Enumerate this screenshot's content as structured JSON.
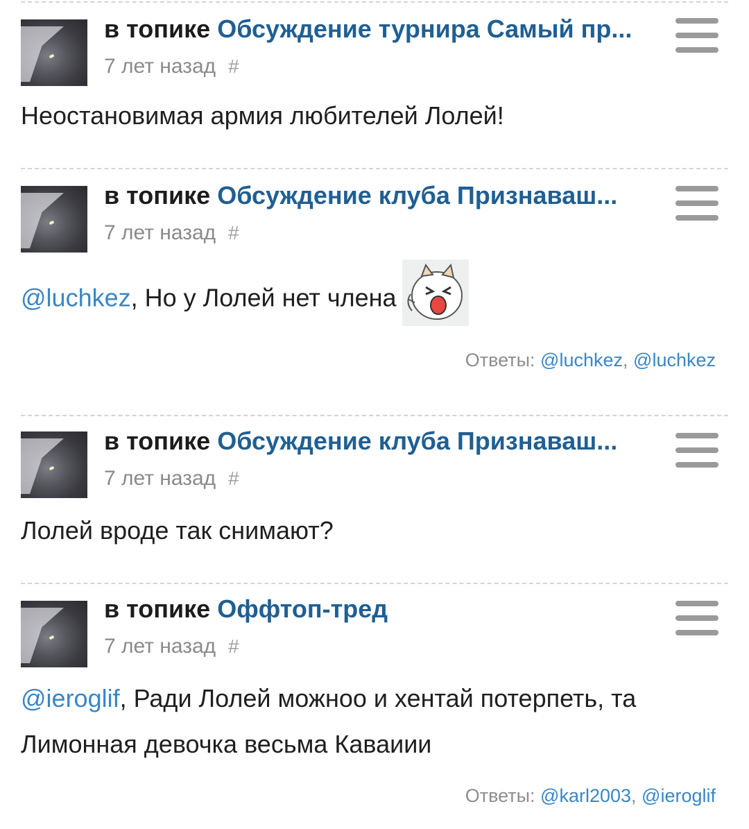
{
  "comments": [
    {
      "topic_prefix": "в топике",
      "topic_title": "Обсуждение турнира Самый пр...",
      "time": "7 лет назад",
      "hash": "#",
      "mention": "",
      "text": "Неостановимая армия любителей Лолей!",
      "has_emote": false,
      "replies_label": "",
      "replies": []
    },
    {
      "topic_prefix": "в топике",
      "topic_title": "Обсуждение клуба Признаваш...",
      "time": "7 лет назад",
      "hash": "#",
      "mention": "@luchkez",
      "text": ", Но у Лолей нет члена",
      "has_emote": true,
      "emote_icon": "crying-cat-emote",
      "replies_label": "Ответы:",
      "replies": [
        "@luchkez",
        "@luchkez"
      ]
    },
    {
      "topic_prefix": "в топике",
      "topic_title": "Обсуждение клуба Признаваш...",
      "time": "7 лет назад",
      "hash": "#",
      "mention": "",
      "text": "Лолей вроде так снимают?",
      "has_emote": false,
      "replies_label": "",
      "replies": []
    },
    {
      "topic_prefix": "в топике",
      "topic_title": "Оффтоп-тред",
      "time": "7 лет назад",
      "hash": "#",
      "mention": "@ieroglif",
      "text": ", Ради Лолей можноо и хентай потерпеть, та Лимонная девочка весьма Каваиии",
      "has_emote": false,
      "replies_label": "Ответы:",
      "replies": [
        "@karl2003",
        "@ieroglif"
      ]
    }
  ],
  "colors": {
    "link": "#1f5f93",
    "mention": "#3a86c4",
    "muted": "#8a8a8a"
  },
  "icons": {
    "menu": "hamburger-menu-icon",
    "avatar": "user-avatar"
  }
}
